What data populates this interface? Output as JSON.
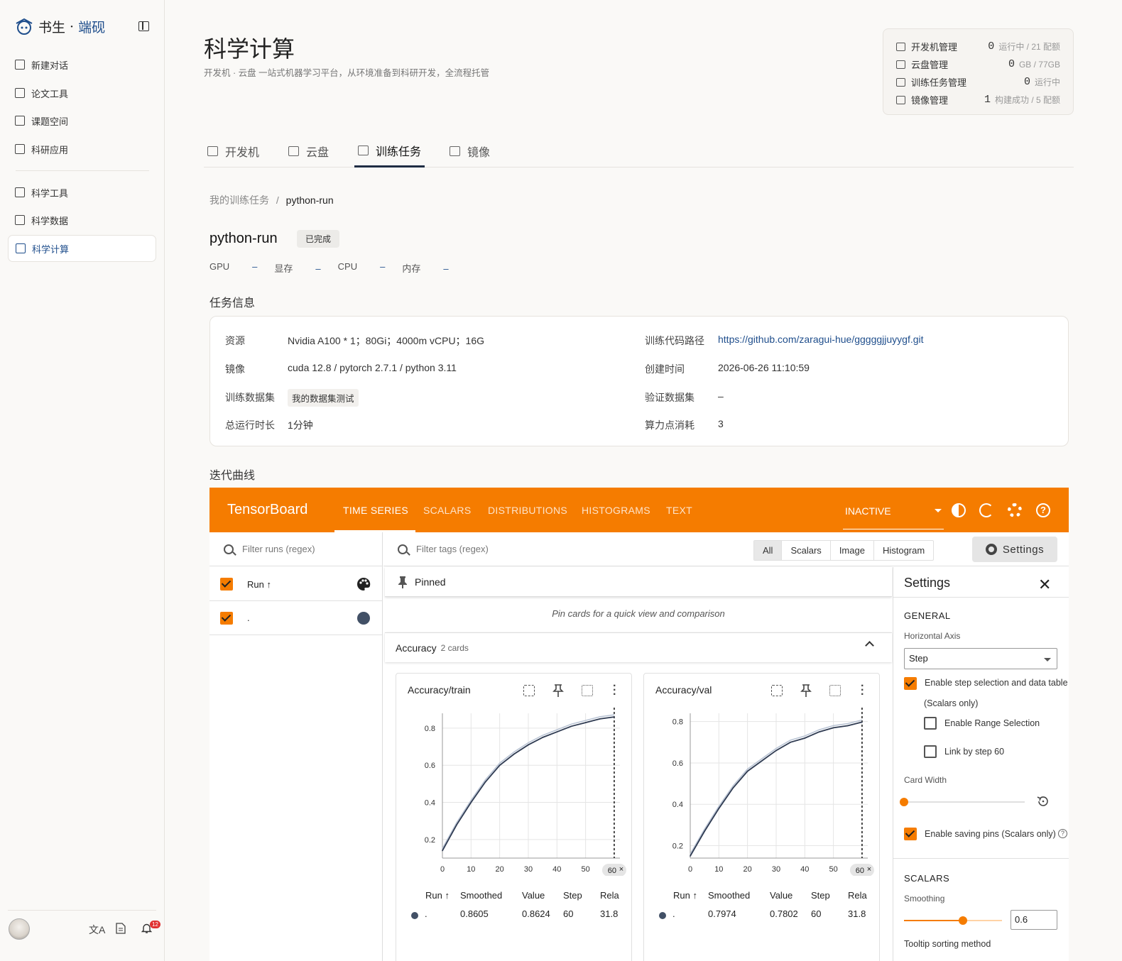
{
  "sidebar": {
    "logo_a": "书生",
    "logo_dot": "·",
    "logo_b": "端砚",
    "items": [
      {
        "label": "新建对话"
      },
      {
        "label": "论文工具"
      },
      {
        "label": "课题空间"
      },
      {
        "label": "科研应用"
      },
      {
        "label": "科学工具"
      },
      {
        "label": "科学数据"
      },
      {
        "label": "科学计算"
      }
    ],
    "translate_icon": "文A",
    "notif_count": "12"
  },
  "header": {
    "title": "科学计算",
    "subtitle": "开发机 · 云盘 一站式机器学习平台，从环境准备到科研开发，全流程托管"
  },
  "stats": [
    {
      "label": "开发机管理",
      "value": "0",
      "unit": "运行中 / 21 配额"
    },
    {
      "label": "云盘管理",
      "value": "0",
      "unit": "GB / 77GB"
    },
    {
      "label": "训练任务管理",
      "value": "0",
      "unit": "运行中"
    },
    {
      "label": "镜像管理",
      "value": "1",
      "unit": "构建成功 / 5 配额"
    }
  ],
  "tabs": [
    {
      "label": "开发机"
    },
    {
      "label": "云盘"
    },
    {
      "label": "训练任务"
    },
    {
      "label": "镜像"
    }
  ],
  "breadcrumb": {
    "parent": "我的训练任务",
    "sep": "/",
    "current": "python-run"
  },
  "task": {
    "name": "python-run",
    "status": "已完成",
    "metrics": [
      {
        "label": "GPU",
        "value": "–"
      },
      {
        "label": "显存",
        "value": "–"
      },
      {
        "label": "CPU",
        "value": "–"
      },
      {
        "label": "内存",
        "value": "–"
      }
    ]
  },
  "info": {
    "section_title": "任务信息",
    "rows": [
      {
        "label": "资源",
        "value": "Nvidia A100 * 1；80Gi；4000m vCPU；16G"
      },
      {
        "label": "镜像",
        "value": "cuda 12.8 / pytorch 2.7.1 / python 3.11"
      },
      {
        "label": "训练数据集",
        "value": "我的数据集测试"
      },
      {
        "label": "总运行时长",
        "value": "1分钟"
      },
      {
        "label": "训练代码路径",
        "value": "https://github.com/zaragui-hue/gggggjjuyygf.git"
      },
      {
        "label": "创建时间",
        "value": "2026-06-26 11:10:59"
      },
      {
        "label": "验证数据集",
        "value": "–"
      },
      {
        "label": "算力点消耗",
        "value": "3"
      }
    ]
  },
  "curves_title": "迭代曲线",
  "tensorboard": {
    "brand": "TensorBoard",
    "tabs": [
      "TIME SERIES",
      "SCALARS",
      "DISTRIBUTIONS",
      "HISTOGRAMS",
      "TEXT"
    ],
    "status": "INACTIVE",
    "filter_runs": "Filter runs (regex)",
    "filter_tags": "Filter tags (regex)",
    "tag_buttons": [
      "All",
      "Scalars",
      "Image",
      "Histogram"
    ],
    "settings_btn": "Settings",
    "run_header": "Run ↑",
    "run_name": ".",
    "pinned": "Pinned",
    "pinned_note": "Pin cards for a quick view and comparison",
    "group": "Accuracy",
    "group_count": "2 cards",
    "table_headers": [
      "Run ↑",
      "Smoothed",
      "Value",
      "Step",
      "Rela"
    ],
    "step_marker": "60",
    "settings": {
      "title": "Settings",
      "general": "GENERAL",
      "horizontal_axis": "Horizontal Axis",
      "axis_value": "Step",
      "enable_step": "Enable step selection and data table",
      "scalars_only": "(Scalars only)",
      "range_selection": "Enable Range Selection",
      "link_step": "Link by step 60",
      "card_width": "Card Width",
      "saving_pins": "Enable saving pins (Scalars only)",
      "scalars": "SCALARS",
      "smoothing": "Smoothing",
      "smoothing_value": "0.6",
      "smoothing_level": 0.6,
      "card_width_level": 0,
      "tooltip": "Tooltip sorting method"
    }
  },
  "chart_data": [
    {
      "type": "line",
      "title": "Accuracy/train",
      "x_ticks": [
        "0",
        "10",
        "20",
        "30",
        "40",
        "50",
        "60"
      ],
      "y_ticks": [
        "0.2",
        "0.4",
        "0.6",
        "0.8"
      ],
      "xlim": [
        0,
        62
      ],
      "ylim": [
        0.1,
        0.88
      ],
      "series": [
        {
          "name": ".",
          "x": [
            0,
            5,
            10,
            15,
            20,
            25,
            30,
            35,
            40,
            45,
            50,
            55,
            60
          ],
          "values": [
            0.14,
            0.28,
            0.4,
            0.51,
            0.6,
            0.66,
            0.71,
            0.75,
            0.78,
            0.81,
            0.83,
            0.85,
            0.8605
          ]
        }
      ],
      "row": {
        "run": ".",
        "smoothed": "0.8605",
        "value": "0.8624",
        "step": "60",
        "relative": "31.8"
      }
    },
    {
      "type": "line",
      "title": "Accuracy/val",
      "x_ticks": [
        "0",
        "10",
        "20",
        "30",
        "40",
        "50",
        "60"
      ],
      "y_ticks": [
        "0.2",
        "0.4",
        "0.6",
        "0.8"
      ],
      "xlim": [
        0,
        62
      ],
      "ylim": [
        0.14,
        0.84
      ],
      "series": [
        {
          "name": ".",
          "x": [
            0,
            5,
            10,
            15,
            20,
            25,
            30,
            35,
            40,
            45,
            50,
            55,
            60
          ],
          "values": [
            0.15,
            0.27,
            0.38,
            0.48,
            0.56,
            0.61,
            0.66,
            0.7,
            0.72,
            0.75,
            0.77,
            0.78,
            0.7974
          ]
        }
      ],
      "row": {
        "run": ".",
        "smoothed": "0.7974",
        "value": "0.7802",
        "step": "60",
        "relative": "31.8"
      }
    }
  ]
}
